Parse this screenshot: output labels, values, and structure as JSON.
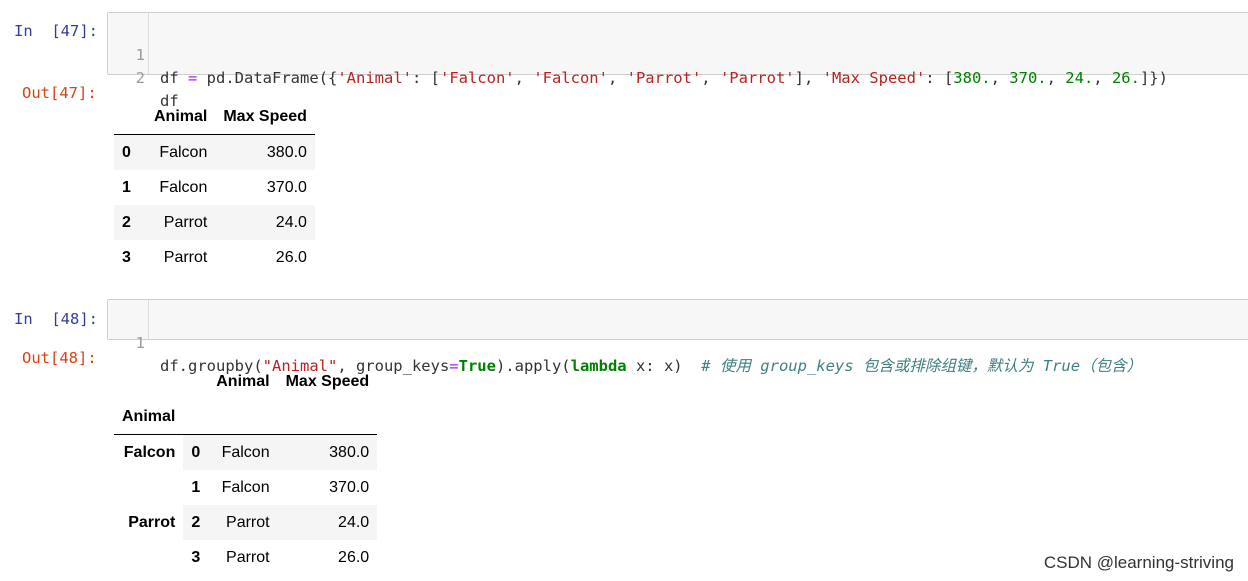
{
  "cell47": {
    "in_prompt": "In  [47]:",
    "out_prompt": "Out[47]:",
    "line1_num": "1",
    "line2_num": "2",
    "line1": {
      "a": "df ",
      "b": "=",
      "c": " pd.DataFrame({",
      "s1": "'Animal'",
      "d": ": [",
      "s2": "'Falcon'",
      "e": ", ",
      "s3": "'Falcon'",
      "f": ", ",
      "s4": "'Parrot'",
      "g": ", ",
      "s5": "'Parrot'",
      "h": "], ",
      "s6": "'Max Speed'",
      "i": ": [",
      "n1": "380.",
      "j": ", ",
      "n2": "370.",
      "k": ", ",
      "n3": "24.",
      "l": ", ",
      "n4": "26.",
      "m": "]})"
    },
    "line2": "df",
    "table": {
      "headers": [
        "",
        "Animal",
        "Max Speed"
      ],
      "rows": [
        {
          "index": "0",
          "animal": "Falcon",
          "speed": "380.0"
        },
        {
          "index": "1",
          "animal": "Falcon",
          "speed": "370.0"
        },
        {
          "index": "2",
          "animal": "Parrot",
          "speed": "24.0"
        },
        {
          "index": "3",
          "animal": "Parrot",
          "speed": "26.0"
        }
      ]
    }
  },
  "cell48": {
    "in_prompt": "In  [48]:",
    "out_prompt": "Out[48]:",
    "line1_num": "1",
    "line1": {
      "a": "df.groupby(",
      "s1": "\"Animal\"",
      "b": ", group_keys",
      "c": "=",
      "kw1": "True",
      "d": ").apply(",
      "kw2": "lambda",
      "e": " x: x)  ",
      "comment": "# 使用 group_keys 包含或排除组键，默认为 True（包含）"
    },
    "table": {
      "col_headers": [
        "Animal",
        "Max Speed"
      ],
      "index_name": "Animal",
      "groups": [
        {
          "key": "Falcon",
          "rows": [
            {
              "index": "0",
              "animal": "Falcon",
              "speed": "380.0"
            },
            {
              "index": "1",
              "animal": "Falcon",
              "speed": "370.0"
            }
          ]
        },
        {
          "key": "Parrot",
          "rows": [
            {
              "index": "2",
              "animal": "Parrot",
              "speed": "24.0"
            },
            {
              "index": "3",
              "animal": "Parrot",
              "speed": "26.0"
            }
          ]
        }
      ]
    }
  },
  "watermark": "CSDN @learning-striving"
}
